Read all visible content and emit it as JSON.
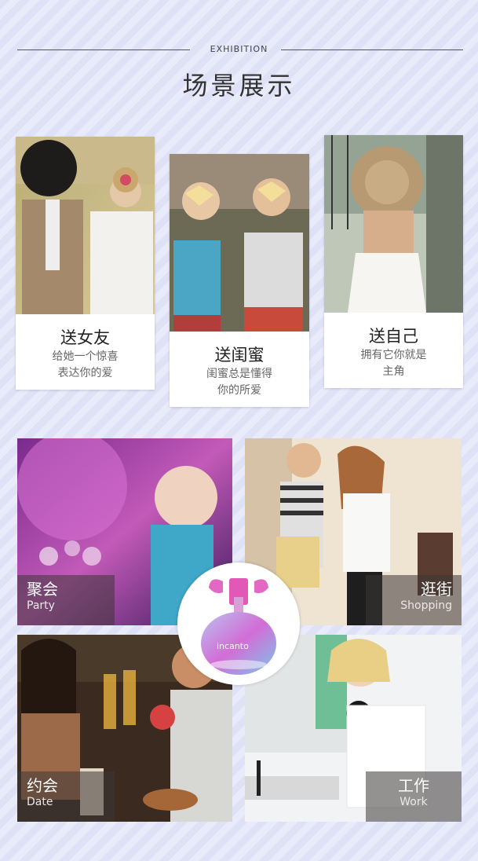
{
  "header": {
    "eyebrow": "EXHIBITION",
    "title": "场景展示"
  },
  "cards": [
    {
      "title": "送女友",
      "line1": "给她一个惊喜",
      "line2": "表达你的爱"
    },
    {
      "title": "送闺蜜",
      "line1": "闺蜜总是懂得",
      "line2": "你的所爱"
    },
    {
      "title": "送自己",
      "line1": "拥有它你就是",
      "line2": "主角"
    }
  ],
  "tiles": [
    {
      "zh": "聚会",
      "en": "Party"
    },
    {
      "zh": "逛街",
      "en": "Shopping"
    },
    {
      "zh": "约会",
      "en": "Date"
    },
    {
      "zh": "工作",
      "en": "Work"
    }
  ],
  "badge": {
    "bottle_text": "incanto"
  }
}
